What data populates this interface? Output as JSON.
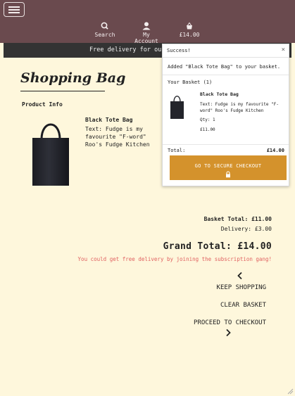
{
  "nav": {
    "search_label": "Search",
    "account_label": "My Account",
    "basket_total": "£14.00"
  },
  "promo": {
    "text": "Free delivery for our su"
  },
  "page": {
    "title": "Shopping Bag",
    "product_info_header": "Product Info"
  },
  "product": {
    "name": "Black Tote Bag",
    "text": "Text: Fudge is my favourite \"F-word\" Roo's Fudge Kitchen"
  },
  "totals": {
    "basket_total": "Basket Total: £11.00",
    "delivery": "Delivery: £3.00",
    "grand_total": "Grand Total: £14.00",
    "free_delivery_msg": "You could get free delivery by joining the subscription gang!"
  },
  "actions": {
    "keep_shopping": "KEEP SHOPPING",
    "clear_basket": "CLEAR BASKET",
    "proceed_checkout": "PROCEED TO CHECKOUT"
  },
  "popup": {
    "title": "Success!",
    "close": "×",
    "message": "Added \"Black Tote Bag\" to your basket.",
    "basket_heading": "Your Basket (1)",
    "item_name": "Black Tote Bag",
    "item_text": "Text: Fudge is my favourite \"F-word\" Roo's Fudge Kitchen",
    "item_qty": "Qty: 1",
    "item_price": "£11.00",
    "total_label": "Total:",
    "total_value": "£14.00",
    "checkout_label": "GO TO SECURE CHECKOUT"
  },
  "colors": {
    "topbar": "#6a4a4e",
    "background": "#fef7dc",
    "promo_bar": "#333333",
    "checkout_button": "#d4922c",
    "free_delivery_text": "#e06060"
  },
  "icons": [
    "hamburger-icon",
    "search-icon",
    "user-icon",
    "basket-icon",
    "chevron-left-icon",
    "chevron-right-icon",
    "lock-icon",
    "close-icon"
  ]
}
